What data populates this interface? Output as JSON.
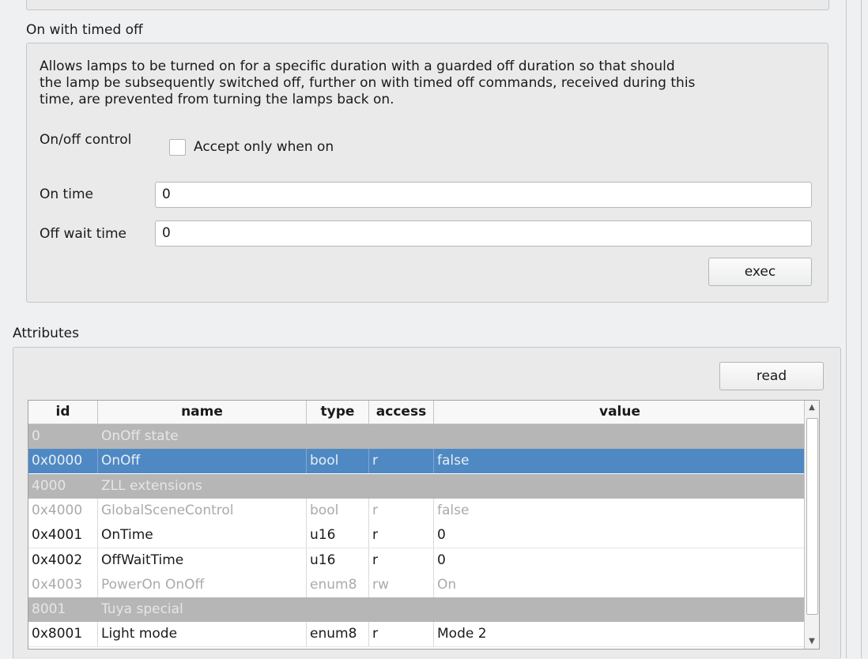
{
  "timed_off": {
    "title": "On with timed off",
    "description_lines": [
      "Allows lamps to be turned on for a specific duration with a guarded off duration so that should",
      "the lamp be subsequently switched off, further on with timed off commands, received during this",
      "time, are prevented from turning the lamps back on."
    ],
    "onoff_control_label": "On/off control",
    "accept_only_label": "Accept only when on",
    "on_time_label": "On time",
    "on_time_value": "0",
    "off_wait_label": "Off wait time",
    "off_wait_value": "0",
    "exec_label": "exec"
  },
  "attributes": {
    "title": "Attributes",
    "read_label": "read",
    "columns": [
      "id",
      "name",
      "type",
      "access",
      "value"
    ],
    "rows": [
      {
        "kind": "group",
        "id": "0",
        "name": "OnOff state",
        "type": "",
        "access": "",
        "value": ""
      },
      {
        "kind": "selected",
        "id": "0x0000",
        "name": "OnOff",
        "type": "bool",
        "access": "r",
        "value": "false"
      },
      {
        "kind": "group",
        "id": "4000",
        "name": "ZLL extensions",
        "type": "",
        "access": "",
        "value": ""
      },
      {
        "kind": "disabled",
        "id": "0x4000",
        "name": "GlobalSceneControl",
        "type": "bool",
        "access": "r",
        "value": "false"
      },
      {
        "kind": "normal",
        "id": "0x4001",
        "name": "OnTime",
        "type": "u16",
        "access": "r",
        "value": "0"
      },
      {
        "kind": "normal",
        "id": "0x4002",
        "name": "OffWaitTime",
        "type": "u16",
        "access": "r",
        "value": "0"
      },
      {
        "kind": "disabled",
        "id": "0x4003",
        "name": "PowerOn OnOff",
        "type": "enum8",
        "access": "rw",
        "value": "On"
      },
      {
        "kind": "group",
        "id": "8001",
        "name": "Tuya special",
        "type": "",
        "access": "",
        "value": ""
      },
      {
        "kind": "normal",
        "id": "0x8001",
        "name": "Light mode",
        "type": "enum8",
        "access": "r",
        "value": "Mode 2"
      }
    ]
  }
}
